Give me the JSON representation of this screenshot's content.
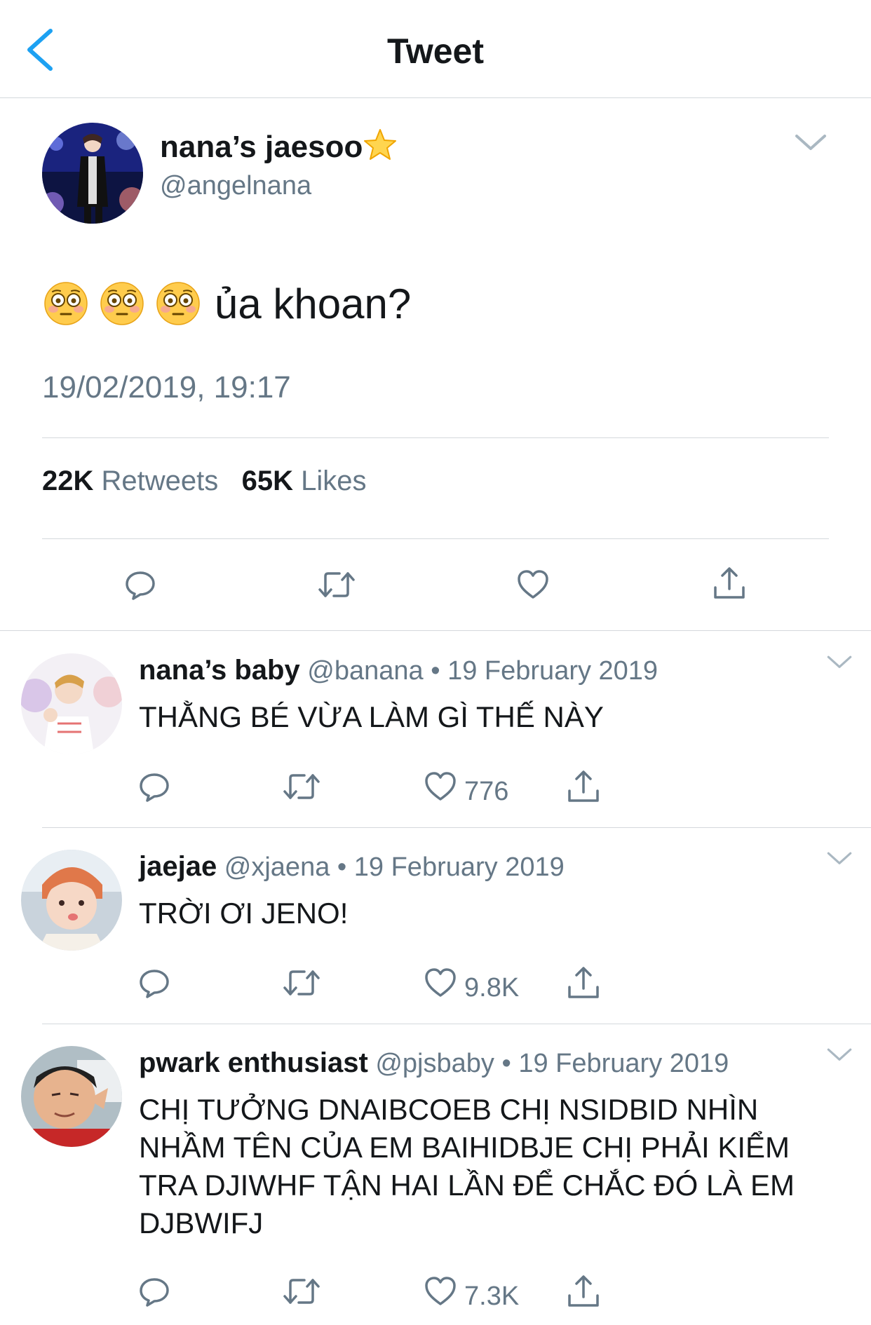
{
  "header": {
    "title": "Tweet",
    "back_icon": "chevron-left-icon",
    "accent": "#1da1f2"
  },
  "tweet": {
    "author_name": "nana’s jaesoo",
    "author_handle": "@angelnana",
    "text": "ủa khoan?",
    "emoji": [
      "flushed-face",
      "flushed-face",
      "flushed-face"
    ],
    "timestamp": "19/02/2019, 19:17",
    "retweets_count": "22K",
    "retweets_label": "Retweets",
    "likes_count": "65K",
    "likes_label": "Likes"
  },
  "replies": [
    {
      "name": "nana’s baby",
      "handle": "@banana",
      "date": "• 19 February 2019",
      "text": "THẰNG BÉ VỪA LÀM GÌ THẾ NÀY",
      "likes": "776"
    },
    {
      "name": "jaejae",
      "handle": "@xjaena",
      "date": "• 19 February 2019",
      "text": "TRỜI ƠI JENO!",
      "likes": "9.8K"
    },
    {
      "name": "pwark enthusiast",
      "handle": "@pjsbaby",
      "date": "• 19 February 2019",
      "text": "CHỊ TƯỞNG DNAIBCOEB CHỊ NSIDBID NHÌN NHẦM TÊN CỦA EM BAIHIDBJE CHỊ PHẢI KIỂM TRA DJIWHF TẬN HAI LẦN ĐỂ CHẮC ĐÓ LÀ EM DJBWIFJ",
      "likes": "7.3K"
    }
  ]
}
